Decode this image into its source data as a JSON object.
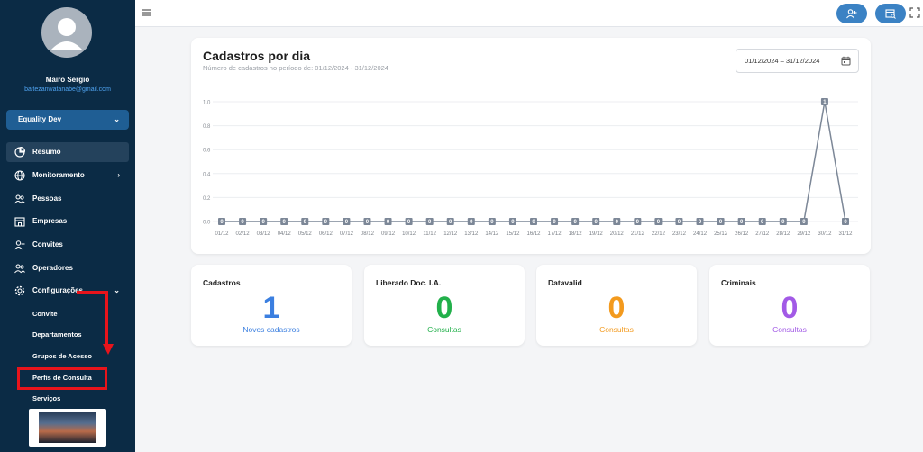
{
  "user": {
    "name": "Mairo Sergio",
    "email": "baltezanwatanabe@gmail.com"
  },
  "organization": {
    "selected": "Equality Dev"
  },
  "nav": {
    "items": [
      {
        "label": "Resumo",
        "icon": "pie-chart-icon",
        "active": true
      },
      {
        "label": "Monitoramento",
        "icon": "globe-icon",
        "expandable": true
      },
      {
        "label": "Pessoas",
        "icon": "people-icon"
      },
      {
        "label": "Empresas",
        "icon": "building-icon"
      },
      {
        "label": "Convites",
        "icon": "add-user-icon"
      },
      {
        "label": "Operadores",
        "icon": "operators-icon"
      },
      {
        "label": "Configurações",
        "icon": "gear-icon",
        "expandable": true,
        "expanded": true
      }
    ],
    "sub_items": [
      "Convite",
      "Departamentos",
      "Grupos de Acesso",
      "Perfis de Consulta",
      "Serviços"
    ]
  },
  "topbar": {
    "menu_icon": "hamburger-icon",
    "buttons": [
      "add-user-icon",
      "store-search-icon"
    ],
    "expand_icon": "fullscreen-icon"
  },
  "chart_card": {
    "title": "Cadastros por dia",
    "subtitle": "Número de cadastros no período de: 01/12/2024 - 31/12/2024",
    "date_range": "01/12/2024 – 31/12/2024"
  },
  "chart_data": {
    "type": "line",
    "x": [
      "01/12",
      "02/12",
      "03/12",
      "04/12",
      "05/12",
      "06/12",
      "07/12",
      "08/12",
      "09/12",
      "10/12",
      "11/12",
      "12/12",
      "13/12",
      "14/12",
      "15/12",
      "16/12",
      "17/12",
      "18/12",
      "19/12",
      "20/12",
      "21/12",
      "22/12",
      "23/12",
      "24/12",
      "25/12",
      "26/12",
      "27/12",
      "28/12",
      "29/12",
      "30/12",
      "31/12"
    ],
    "values": [
      0,
      0,
      0,
      0,
      0,
      0,
      0,
      0,
      0,
      0,
      0,
      0,
      0,
      0,
      0,
      0,
      0,
      0,
      0,
      0,
      0,
      0,
      0,
      0,
      0,
      0,
      0,
      0,
      0,
      1,
      0
    ],
    "data_labels": [
      "0",
      "0",
      "0",
      "0",
      "0",
      "0",
      "0",
      "0",
      "0",
      "0",
      "0",
      "0",
      "0",
      "0",
      "0",
      "0",
      "0",
      "0",
      "0",
      "0",
      "0",
      "0",
      "0",
      "0",
      "0",
      "0",
      "0",
      "0",
      "0",
      "1",
      "0"
    ],
    "yticks": [
      "0.0",
      "0.2",
      "0.4",
      "0.6",
      "0.8",
      "1.0"
    ],
    "ylim": [
      0,
      1
    ],
    "grid": true,
    "line_color": "#7c8797"
  },
  "stats": [
    {
      "label": "Cadastros",
      "value": "1",
      "caption": "Novos cadastros",
      "color": "#3b7fe0"
    },
    {
      "label": "Liberado Doc. I.A.",
      "value": "0",
      "caption": "Consultas",
      "color": "#22b04b"
    },
    {
      "label": "Datavalid",
      "value": "0",
      "caption": "Consultas",
      "color": "#f39a1e"
    },
    {
      "label": "Criminais",
      "value": "0",
      "caption": "Consultas",
      "color": "#a25ae6"
    }
  ]
}
